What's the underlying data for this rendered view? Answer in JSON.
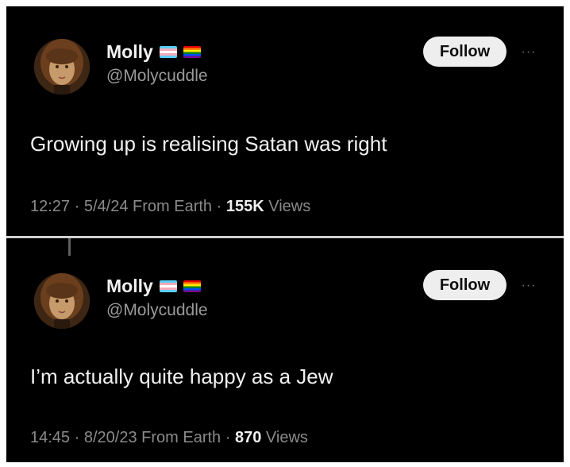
{
  "colors": {
    "background": "#000000",
    "primary_text": "#f0f0f0",
    "secondary_text": "#8a8a8a",
    "follow_button_bg": "#eeeeee",
    "divider": "#cfcfcf"
  },
  "tweets": [
    {
      "display_name": "Molly",
      "flags": [
        "transgender-flag-icon",
        "pride-flag-icon"
      ],
      "handle": "@Molycuddle",
      "follow_label": "Follow",
      "more_label": "···",
      "text": "Growing up is realising Satan was right",
      "time": "12:27",
      "date": "5/4/24",
      "source": "From Earth",
      "views_count": "155K",
      "views_label": "Views"
    },
    {
      "display_name": "Molly",
      "flags": [
        "transgender-flag-icon",
        "pride-flag-icon"
      ],
      "handle": "@Molycuddle",
      "follow_label": "Follow",
      "more_label": "···",
      "text": "I’m actually quite happy as a Jew",
      "time": "14:45",
      "date": "8/20/23",
      "source": "From Earth",
      "views_count": "870",
      "views_label": "Views"
    }
  ],
  "separator": "·"
}
